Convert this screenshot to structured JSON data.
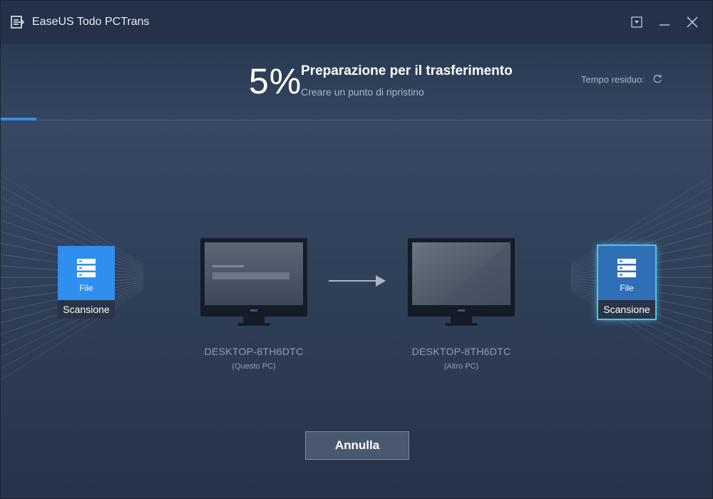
{
  "app": {
    "title": "EaseUS Todo PCTrans",
    "logo_icon": "easeus-logo-icon"
  },
  "window_controls": {
    "menu_icon": "dropdown-menu-icon",
    "minimize_icon": "minimize-icon",
    "close_icon": "close-icon"
  },
  "progress": {
    "percent_label": "5%",
    "percent_value": 5,
    "stage_title": "Preparazione per il trasferimento",
    "stage_subtitle": "Creare un punto di ripristino",
    "remaining_label": "Tempo residuo:",
    "remaining_icon": "refresh-icon",
    "bar_color": "#2e8fe8"
  },
  "source": {
    "tile": {
      "icon": "file-server-icon",
      "label": "File",
      "status": "Scansione"
    },
    "pc_name": "DESKTOP-8TH6DTC",
    "pc_role": "(Questo PC)"
  },
  "destination": {
    "tile": {
      "icon": "file-server-icon",
      "label": "File",
      "status": "Scansione"
    },
    "pc_name": "DESKTOP-8TH6DTC",
    "pc_role": "(Altro PC)"
  },
  "transfer_arrow_icon": "arrow-right-icon",
  "actions": {
    "cancel_label": "Annulla"
  },
  "colors": {
    "accent": "#2f8ff0",
    "highlight": "#4cc3e6",
    "background": "#34445e"
  }
}
